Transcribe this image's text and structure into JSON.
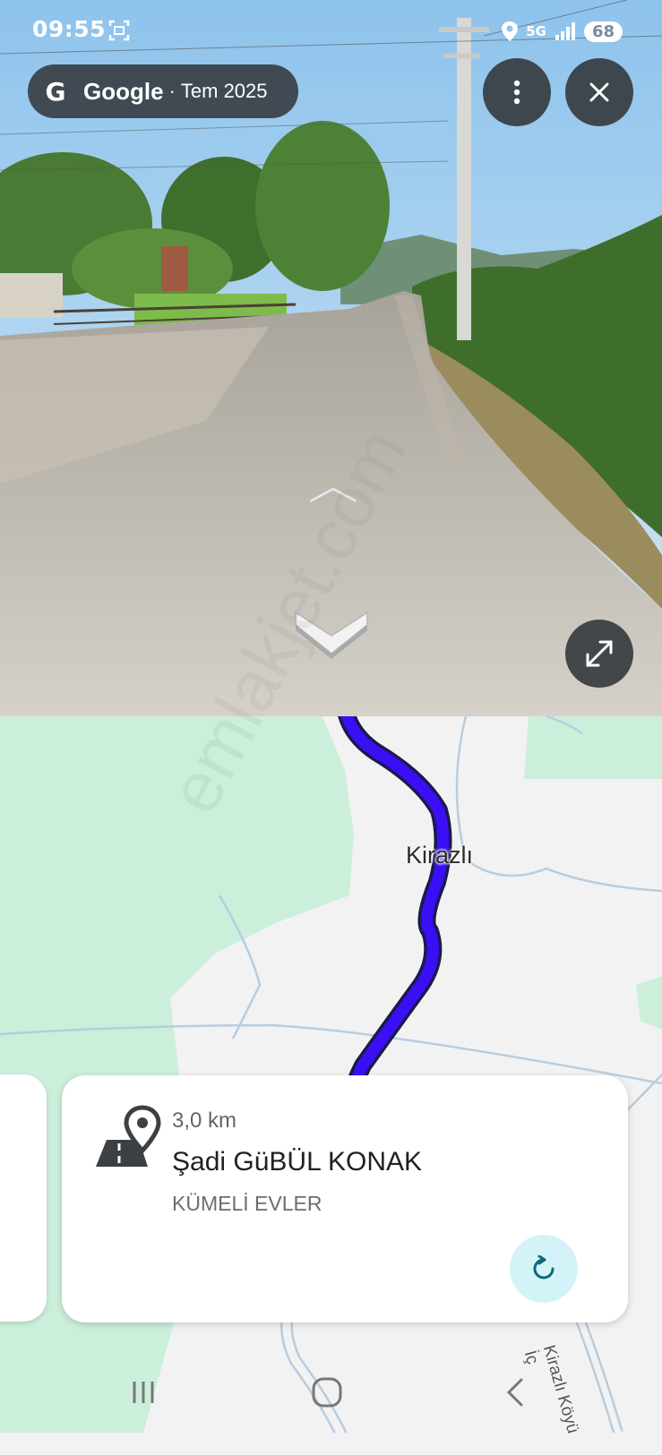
{
  "status_bar": {
    "time": "09:55",
    "network": "5G",
    "battery": "68"
  },
  "streetview": {
    "source_brand": "Google",
    "separator": "·",
    "capture_date": "Tem 2025",
    "icons": {
      "brand": "google-g-icon",
      "more": "more-vert-icon",
      "close": "close-icon",
      "expand": "expand-icon",
      "forward": "chevron-up-icon",
      "back": "chevron-down-icon"
    }
  },
  "map": {
    "place_label": "Kirazlı",
    "road_label": "Kirazlı Köyü İç",
    "route_color": "#3b0ff5",
    "green_color": "#cbefdb"
  },
  "watermark": "emlakjet.com",
  "place_card": {
    "distance": "3,0 km",
    "title": "Şadi GüBÜL KONAK",
    "subtitle": "KÜMELİ EVLER",
    "icons": {
      "place": "road-pin-icon",
      "action": "refresh-icon"
    },
    "action_bg": "#d4f3f9"
  },
  "nav_bar": {
    "recents": "recents-icon",
    "home": "home-icon",
    "back": "back-icon"
  }
}
